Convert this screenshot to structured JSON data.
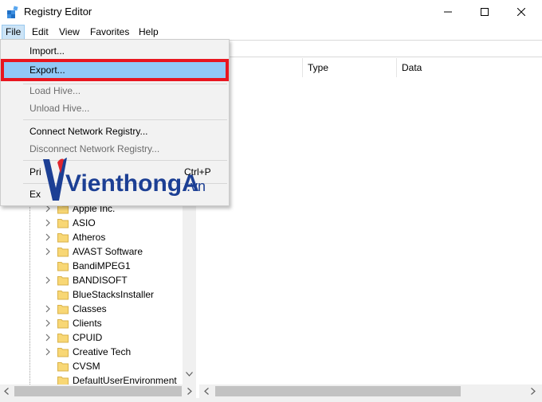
{
  "window": {
    "title": "Registry Editor",
    "icons": {
      "app": "registry-cubes-icon",
      "minimize": "minimize-icon",
      "maximize": "maximize-icon",
      "close": "close-icon"
    }
  },
  "menubar": {
    "file": "File",
    "edit": "Edit",
    "view": "View",
    "favorites": "Favorites",
    "help": "Help"
  },
  "file_menu": {
    "items": [
      {
        "label": "Import...",
        "enabled": true
      },
      {
        "label": "Export...",
        "enabled": true,
        "highlighted": true
      },
      {
        "label": "Load Hive...",
        "enabled": false
      },
      {
        "label": "Unload Hive...",
        "enabled": false
      },
      {
        "label": "Connect Network Registry...",
        "enabled": true
      },
      {
        "label": "Disconnect Network Registry...",
        "enabled": false
      },
      {
        "label": "Print...",
        "visible_fragment": "Pri",
        "shortcut_fragment": "Ctrl+P",
        "enabled": true
      },
      {
        "label": "Exit",
        "visible_fragment": "Ex",
        "enabled": true
      }
    ],
    "highlight_color": "#91c9f7",
    "callout_color": "#e8161f"
  },
  "list_columns": {
    "name_fragment": "e",
    "type": "Type",
    "data": "Data"
  },
  "tree": {
    "items": [
      "Apple Inc.",
      "ASIO",
      "Atheros",
      "AVAST Software",
      "BandiMPEG1",
      "BANDISOFT",
      "BlueStacksInstaller",
      "Classes",
      "Clients",
      "CPUID",
      "Creative Tech",
      "CVSM",
      "DefaultUserEnvironment"
    ],
    "expandable": [
      true,
      true,
      true,
      true,
      false,
      true,
      false,
      true,
      true,
      true,
      true,
      false,
      false
    ],
    "folder_color": "#f8d775"
  },
  "watermark": {
    "text_main": "VienthongA",
    "text_tld": ".vn",
    "brand_blue": "#1c3f94",
    "brand_red": "#e0262e"
  }
}
